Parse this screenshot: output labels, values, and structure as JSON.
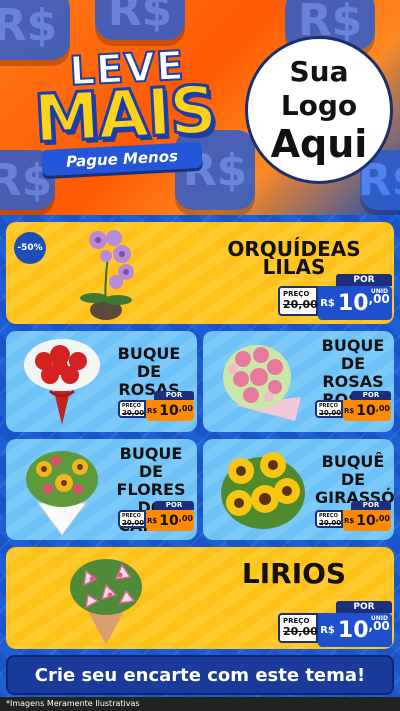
{
  "header": {
    "logo_line1": "LEVE",
    "logo_line2": "MAIS",
    "logo_tag": "Pague Menos",
    "brand_line1": "Sua Logo",
    "brand_line2": "Aqui",
    "bg_symbol": "R$"
  },
  "products": [
    {
      "title": "ORQUÍDEAS LILAS",
      "discount": "-50%",
      "por": "POR",
      "preco_label": "PREÇO",
      "old": "20,00",
      "currency": "R$",
      "price_int": "10",
      "price_cents": ",00",
      "unit": "UNID",
      "image": "orchid-icon"
    },
    {
      "title": "BUQUE DE ROSAS",
      "por": "POR",
      "preco_label": "PREÇO",
      "old": "20,00",
      "currency": "R$",
      "price_int": "10",
      "price_cents": ",00",
      "image": "red-roses-bouquet-icon"
    },
    {
      "title": "BUQUE DE ROSAS ROSAS",
      "por": "POR",
      "preco_label": "PREÇO",
      "old": "20,00",
      "currency": "R$",
      "price_int": "10",
      "price_cents": ",00",
      "image": "pink-roses-bouquet-icon"
    },
    {
      "title": "BUQUE DE FLORES DO CAMPO",
      "por": "POR",
      "preco_label": "PREÇO",
      "old": "20,00",
      "currency": "R$",
      "price_int": "10",
      "price_cents": ",00",
      "image": "wildflowers-bouquet-icon"
    },
    {
      "title": "BUQUÊ DE GIRASSÓIS",
      "por": "POR",
      "preco_label": "PREÇO",
      "old": "20,00",
      "currency": "R$",
      "price_int": "10",
      "price_cents": ",00",
      "image": "sunflower-bouquet-icon"
    },
    {
      "title": "LIRIOS",
      "por": "POR",
      "preco_label": "PREÇO",
      "old": "20,00",
      "currency": "R$",
      "price_int": "10",
      "price_cents": ",00",
      "unit": "UNID",
      "image": "lily-bouquet-icon"
    }
  ],
  "cta": "Crie seu encarte com este tema!",
  "footer": "*Imagens Meramente Ilustrativas",
  "colors": {
    "orange": "#ff5a00",
    "yellow": "#ffc21a",
    "light_blue": "#6ec2f7",
    "navy": "#1b2f7c",
    "blue": "#1e4fcc"
  }
}
